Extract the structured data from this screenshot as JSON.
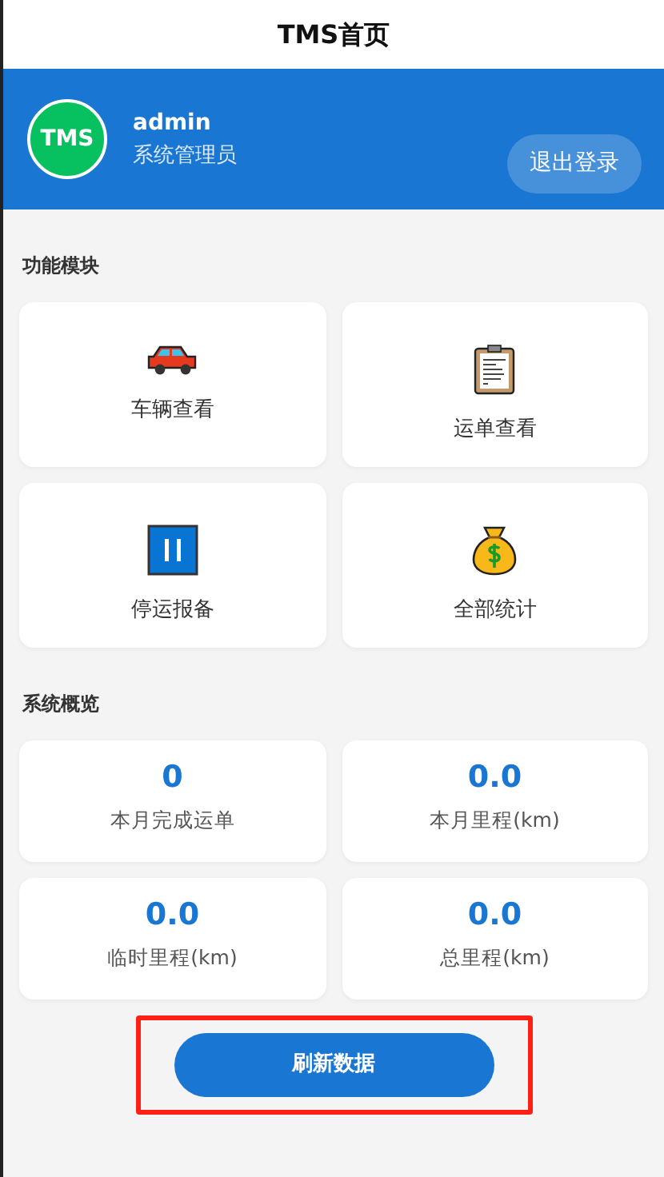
{
  "header": {
    "title": "TMS首页"
  },
  "user": {
    "avatar_text": "TMS",
    "name": "admin",
    "role": "系统管理员",
    "logout": "退出登录"
  },
  "modules_title": "功能模块",
  "modules": [
    {
      "kind": "car",
      "label": "车辆查看"
    },
    {
      "kind": "clipboard",
      "label": "运单查看"
    },
    {
      "kind": "pause",
      "label": "停运报备"
    },
    {
      "kind": "moneybag",
      "label": "全部统计"
    }
  ],
  "overview_title": "系统概览",
  "stats": [
    {
      "value": "0",
      "label": "本月完成运单"
    },
    {
      "value": "0.0",
      "label": "本月里程(km)"
    },
    {
      "value": "0.0",
      "label": "临时里程(km)"
    },
    {
      "value": "0.0",
      "label": "总里程(km)"
    }
  ],
  "refresh": {
    "label": "刷新数据",
    "highlighted": true
  }
}
